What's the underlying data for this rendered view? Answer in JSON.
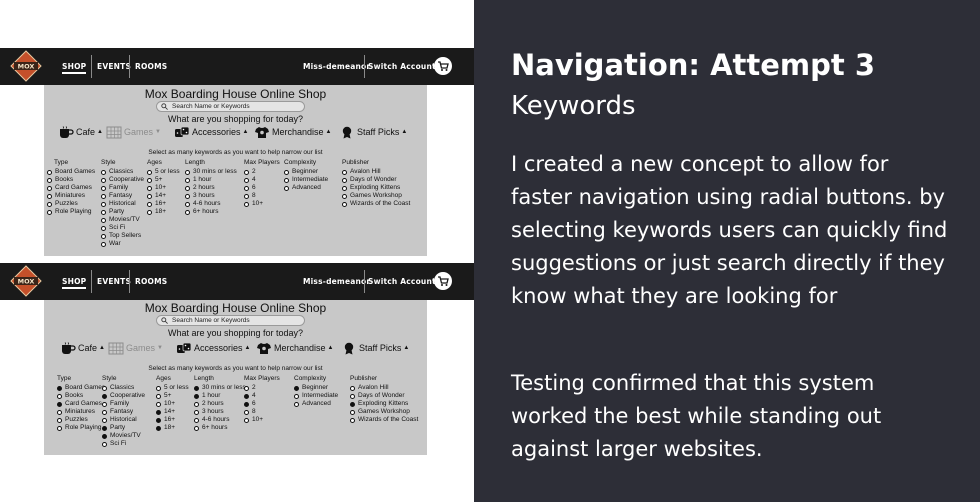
{
  "mockups": [
    {
      "nav": {
        "logo_text": "MOX",
        "links": [
          "SHOP",
          "EVENTS",
          "ROOMS"
        ],
        "user": "Miss-demeanor",
        "switch_account": "Switch Account"
      },
      "shop_title": "Mox Boarding House Online Shop",
      "search_placeholder": "Search Name or Keywords",
      "question": "What are you shopping for today?",
      "categories": [
        {
          "label": "Cafe",
          "icon": "coffee-cup-icon",
          "arrow": "▲",
          "dim": false
        },
        {
          "label": "Games",
          "icon": "board-game-icon",
          "arrow": "▼",
          "dim": true
        },
        {
          "label": "Accessories",
          "icon": "dice-icon",
          "arrow": "▲",
          "dim": false
        },
        {
          "label": "Merchandise",
          "icon": "shirt-icon",
          "arrow": "▲",
          "dim": false
        },
        {
          "label": "Staff Picks",
          "icon": "award-icon",
          "arrow": "▲",
          "dim": false
        }
      ],
      "select_note": "Select as many keywords as you want to help narrow our list",
      "filters": [
        {
          "head": "Type",
          "options": [
            {
              "label": "Board Games",
              "on": false
            },
            {
              "label": "Books",
              "on": false
            },
            {
              "label": "Card Games",
              "on": false
            },
            {
              "label": "Miniatures",
              "on": false
            },
            {
              "label": "Puzzles",
              "on": false
            },
            {
              "label": "Role Playing",
              "on": false
            }
          ]
        },
        {
          "head": "Style",
          "options": [
            {
              "label": "Classics",
              "on": false
            },
            {
              "label": "Cooperative",
              "on": false
            },
            {
              "label": "Family",
              "on": false
            },
            {
              "label": "Fantasy",
              "on": false
            },
            {
              "label": "Historical",
              "on": false
            },
            {
              "label": "Party",
              "on": false
            },
            {
              "label": "Movies/TV",
              "on": false
            },
            {
              "label": "Sci Fi",
              "on": false
            },
            {
              "label": "Top Sellers",
              "on": false
            },
            {
              "label": "War",
              "on": false
            }
          ]
        },
        {
          "head": "Ages",
          "options": [
            {
              "label": "5 or less",
              "on": false
            },
            {
              "label": "5+",
              "on": false
            },
            {
              "label": "10+",
              "on": false
            },
            {
              "label": "14+",
              "on": false
            },
            {
              "label": "16+",
              "on": false
            },
            {
              "label": "18+",
              "on": false
            }
          ]
        },
        {
          "head": "Length",
          "options": [
            {
              "label": "30 mins or less",
              "on": false
            },
            {
              "label": "1 hour",
              "on": false
            },
            {
              "label": "2 hours",
              "on": false
            },
            {
              "label": "3 hours",
              "on": false
            },
            {
              "label": "4-6 hours",
              "on": false
            },
            {
              "label": "6+ hours",
              "on": false
            }
          ]
        },
        {
          "head": "Max Players",
          "options": [
            {
              "label": "2",
              "on": false
            },
            {
              "label": "4",
              "on": false
            },
            {
              "label": "6",
              "on": false
            },
            {
              "label": "8",
              "on": false
            },
            {
              "label": "10+",
              "on": false
            }
          ]
        },
        {
          "head": "Complexity",
          "options": [
            {
              "label": "Beginner",
              "on": false
            },
            {
              "label": "Intermediate",
              "on": false
            },
            {
              "label": "Advanced",
              "on": false
            }
          ]
        },
        {
          "head": "Publisher",
          "options": [
            {
              "label": "Avalon Hill",
              "on": false
            },
            {
              "label": "Days of Wonder",
              "on": false
            },
            {
              "label": "Exploding Kittens",
              "on": false
            },
            {
              "label": "Games Workshop",
              "on": false
            },
            {
              "label": "Wizards of the Coast",
              "on": false
            }
          ]
        }
      ]
    },
    {
      "nav": {
        "logo_text": "MOX",
        "links": [
          "SHOP",
          "EVENTS",
          "ROOMS"
        ],
        "user": "Miss-demeanor",
        "switch_account": "Switch Account"
      },
      "shop_title": "Mox Boarding House Online Shop",
      "search_placeholder": "Search Name or Keywords",
      "question": "What are you shopping for today?",
      "categories": [
        {
          "label": "Cafe",
          "icon": "coffee-cup-icon",
          "arrow": "▲",
          "dim": false
        },
        {
          "label": "Games",
          "icon": "board-game-icon",
          "arrow": "▼",
          "dim": true
        },
        {
          "label": "Accessories",
          "icon": "dice-icon",
          "arrow": "▲",
          "dim": false
        },
        {
          "label": "Merchandise",
          "icon": "shirt-icon",
          "arrow": "▲",
          "dim": false
        },
        {
          "label": "Staff Picks",
          "icon": "award-icon",
          "arrow": "▲",
          "dim": false
        }
      ],
      "select_note": "Select as many keywords as you want to help narrow our list",
      "filters": [
        {
          "head": "Type",
          "options": [
            {
              "label": "Board Games",
              "on": true
            },
            {
              "label": "Books",
              "on": false
            },
            {
              "label": "Card Games",
              "on": true
            },
            {
              "label": "Miniatures",
              "on": false
            },
            {
              "label": "Puzzles",
              "on": false
            },
            {
              "label": "Role Playing",
              "on": false
            }
          ]
        },
        {
          "head": "Style",
          "options": [
            {
              "label": "Classics",
              "on": false
            },
            {
              "label": "Cooperative",
              "on": true
            },
            {
              "label": "Family",
              "on": false
            },
            {
              "label": "Fantasy",
              "on": false
            },
            {
              "label": "Historical",
              "on": false
            },
            {
              "label": "Party",
              "on": true
            },
            {
              "label": "Movies/TV",
              "on": true
            },
            {
              "label": "Sci Fi",
              "on": false
            }
          ]
        },
        {
          "head": "Ages",
          "options": [
            {
              "label": "5 or less",
              "on": false
            },
            {
              "label": "5+",
              "on": false
            },
            {
              "label": "10+",
              "on": false
            },
            {
              "label": "14+",
              "on": true
            },
            {
              "label": "16+",
              "on": true
            },
            {
              "label": "18+",
              "on": true
            }
          ]
        },
        {
          "head": "Length",
          "options": [
            {
              "label": "30 mins or less",
              "on": true
            },
            {
              "label": "1 hour",
              "on": true
            },
            {
              "label": "2 hours",
              "on": false
            },
            {
              "label": "3 hours",
              "on": false
            },
            {
              "label": "4-6 hours",
              "on": false
            },
            {
              "label": "6+ hours",
              "on": false
            }
          ]
        },
        {
          "head": "Max Players",
          "options": [
            {
              "label": "2",
              "on": false
            },
            {
              "label": "4",
              "on": true
            },
            {
              "label": "6",
              "on": true
            },
            {
              "label": "8",
              "on": false
            },
            {
              "label": "10+",
              "on": false
            }
          ]
        },
        {
          "head": "Complexity",
          "options": [
            {
              "label": "Beginner",
              "on": true
            },
            {
              "label": "Intermediate",
              "on": false
            },
            {
              "label": "Advanced",
              "on": false
            }
          ]
        },
        {
          "head": "Publisher",
          "options": [
            {
              "label": "Avalon Hill",
              "on": false
            },
            {
              "label": "Days of Wonder",
              "on": false
            },
            {
              "label": "Exploding Kittens",
              "on": true
            },
            {
              "label": "Games Workshop",
              "on": false
            },
            {
              "label": "Wizards of the Coast",
              "on": false
            }
          ]
        }
      ]
    }
  ],
  "right_panel": {
    "title": "Navigation: Attempt 3",
    "subtitle": "Keywords",
    "paragraph1": "I created a new concept to allow for faster navigation using radial buttons. by selecting keywords users can quickly find suggestions or just search directly if they know what they are looking for",
    "paragraph2": "Testing confirmed that this system worked the best while standing out against larger websites."
  },
  "colors": {
    "dark_panel": "#2d2e37",
    "nav_bar": "#1a1a1a",
    "mock_panel": "#c8c8c8",
    "logo_orange": "#c4502a"
  }
}
